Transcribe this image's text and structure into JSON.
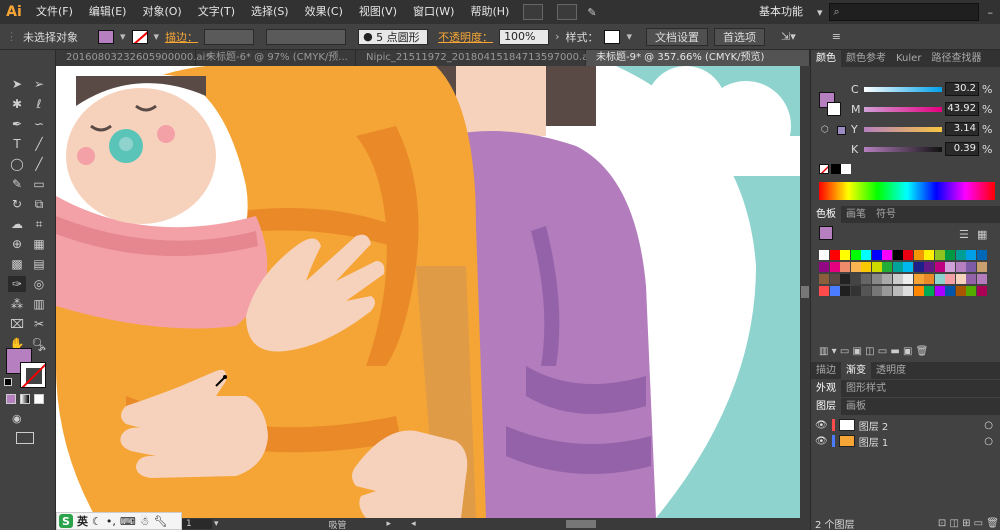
{
  "app": {
    "logo": "Ai"
  },
  "menu": [
    "文件(F)",
    "编辑(E)",
    "对象(O)",
    "文字(T)",
    "选择(S)",
    "效果(C)",
    "视图(V)",
    "窗口(W)",
    "帮助(H)"
  ],
  "workspace": "基本功能",
  "control": {
    "selection_status": "未选择对象",
    "fill_color": "#b57fc0",
    "stroke_label": "描边：",
    "brush": "5 点圆形",
    "opacity_label": "不透明度：",
    "opacity_value": "100%",
    "style_label": "样式：",
    "doc_setup": "文档设置",
    "preferences": "首选项"
  },
  "tabs": [
    {
      "label": "20160803232605900000.ai*",
      "active": false
    },
    {
      "label": "未标题-6* @ 97% (CMYK/预...",
      "active": false
    },
    {
      "label": "Nipic_21511972_20180415184713597000.ai*",
      "active": false
    },
    {
      "label": "未标题-9* @ 357.66% (CMYK/预览)",
      "active": true
    }
  ],
  "colors_panel": {
    "tabs": [
      "颜色",
      "颜色参考",
      "Kuler",
      "路径查找器"
    ],
    "channels": [
      {
        "label": "C",
        "value": "30.2",
        "unit": "%"
      },
      {
        "label": "M",
        "value": "43.92",
        "unit": "%"
      },
      {
        "label": "Y",
        "value": "3.14",
        "unit": "%"
      },
      {
        "label": "K",
        "value": "0.39",
        "unit": "%"
      }
    ]
  },
  "swatches_panel": {
    "tabs": [
      "色板",
      "画笔",
      "符号"
    ]
  },
  "stroke_panel": {
    "tabs": [
      "描边",
      "渐变",
      "透明度"
    ]
  },
  "appearance_panel": {
    "tabs": [
      "外观",
      "图形样式"
    ]
  },
  "layers_panel": {
    "tabs": [
      "图层",
      "画板"
    ],
    "layers": [
      {
        "name": "图层 2",
        "color": "#ff4b4b"
      },
      {
        "name": "图层 1",
        "color": "#4b7bff"
      }
    ],
    "count_label": "2 个图层"
  },
  "status": {
    "zoom": "1",
    "tool": "吸管"
  },
  "ime": {
    "lang": "英",
    "logo": "S"
  },
  "palette": {
    "orange": "#f5a436",
    "orange_dark": "#e98927",
    "purple": "#b27cbd",
    "purple_dark": "#9462a8",
    "skin": "#f6d2bd",
    "teal": "#8fd3cf",
    "pink": "#f3a1a7",
    "hair": "#5a4a45"
  }
}
